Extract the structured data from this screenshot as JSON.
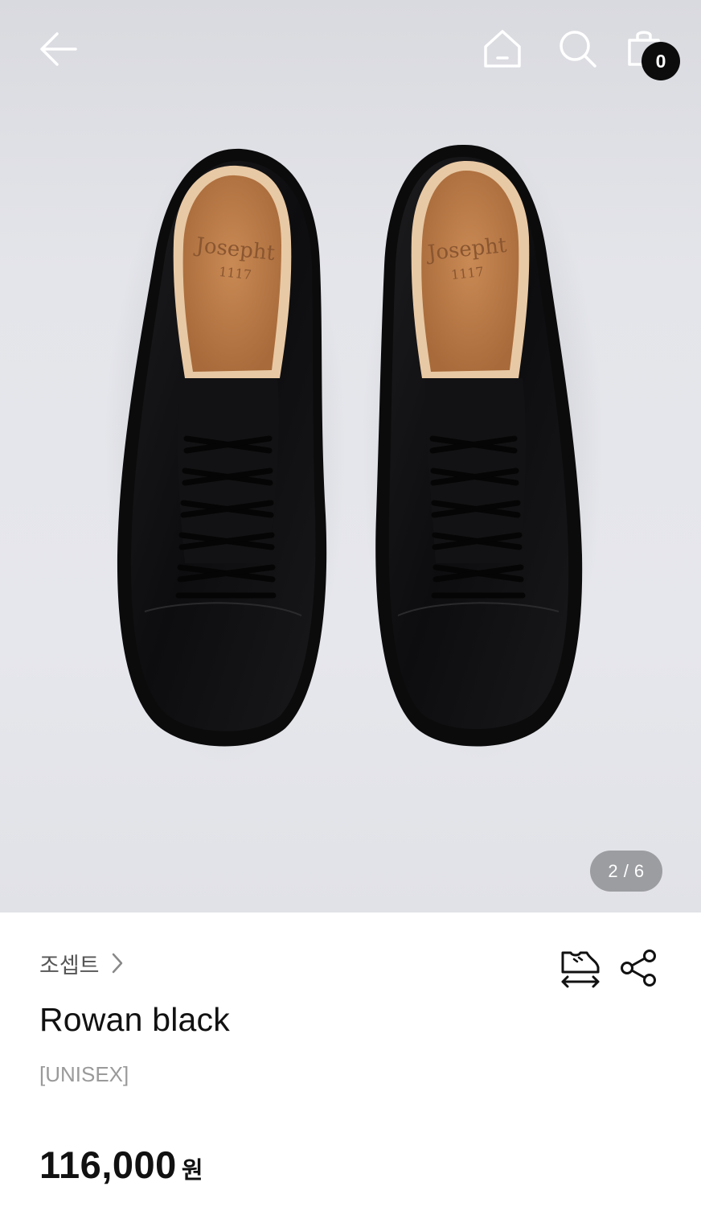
{
  "header": {
    "back_icon": "arrow-left-icon",
    "home_icon": "home-icon",
    "search_icon": "search-icon",
    "cart_icon": "shopping-bag-icon",
    "cart_count": "0"
  },
  "gallery": {
    "current": 2,
    "total": 6,
    "counter_text": "2 / 6",
    "image": {
      "brand_print": "Josepht",
      "print_number": "1117"
    }
  },
  "product": {
    "brand": "조셉트",
    "name": "Rowan black",
    "tag": "[UNISEX]",
    "price": "116,000",
    "currency": "원"
  },
  "actions": {
    "size_guide_icon": "shoe-size-icon",
    "share_icon": "share-icon"
  },
  "colors": {
    "badge": "#0c0c0c",
    "text": "#111111",
    "muted": "#9a9a9a",
    "hero_background": "#e4e5ea"
  }
}
